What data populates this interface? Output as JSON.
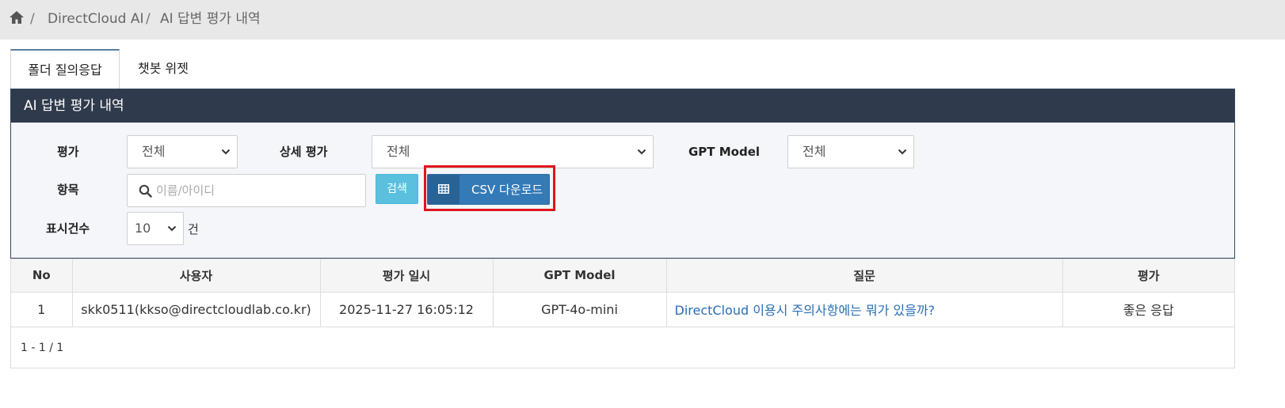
{
  "breadcrumb": {
    "home_icon": "home-icon",
    "items": [
      "DirectCloud AI",
      "AI 답변 평가 내역"
    ],
    "separator": "/"
  },
  "tabs": [
    {
      "label": "폴더 질의응답",
      "active": true
    },
    {
      "label": "챗봇 위젯",
      "active": false
    }
  ],
  "panel": {
    "title": "AI 답변 평가 내역",
    "filters": {
      "rating_label": "평가",
      "rating_value": "전체",
      "detail_label": "상세 평가",
      "detail_value": "전체",
      "model_label": "GPT Model",
      "model_value": "전체",
      "item_label": "항목",
      "item_placeholder": "이름/아이디",
      "count_label": "표시건수",
      "count_value": "10",
      "count_suffix": "건"
    },
    "buttons": {
      "search": "검색",
      "csv": "CSV 다운로드"
    }
  },
  "table": {
    "headers": [
      "No",
      "사용자",
      "평가 일시",
      "GPT Model",
      "질문",
      "평가"
    ],
    "rows": [
      [
        "1",
        "skk0511(kkso@directcloudlab.co.kr)",
        "2025-11-27 16:05:12",
        "GPT-4o-mini",
        "DirectCloud 이용시 주의사항에는 뭐가 있을까?",
        "좋은 응답"
      ]
    ],
    "pagination": "1 - 1 / 1"
  },
  "colors": {
    "panel_header": "#2f3b4c",
    "csv_button": "#337ab7",
    "search_button": "#5bc0de",
    "highlight": "#e0141e",
    "link": "#2a6db5"
  }
}
